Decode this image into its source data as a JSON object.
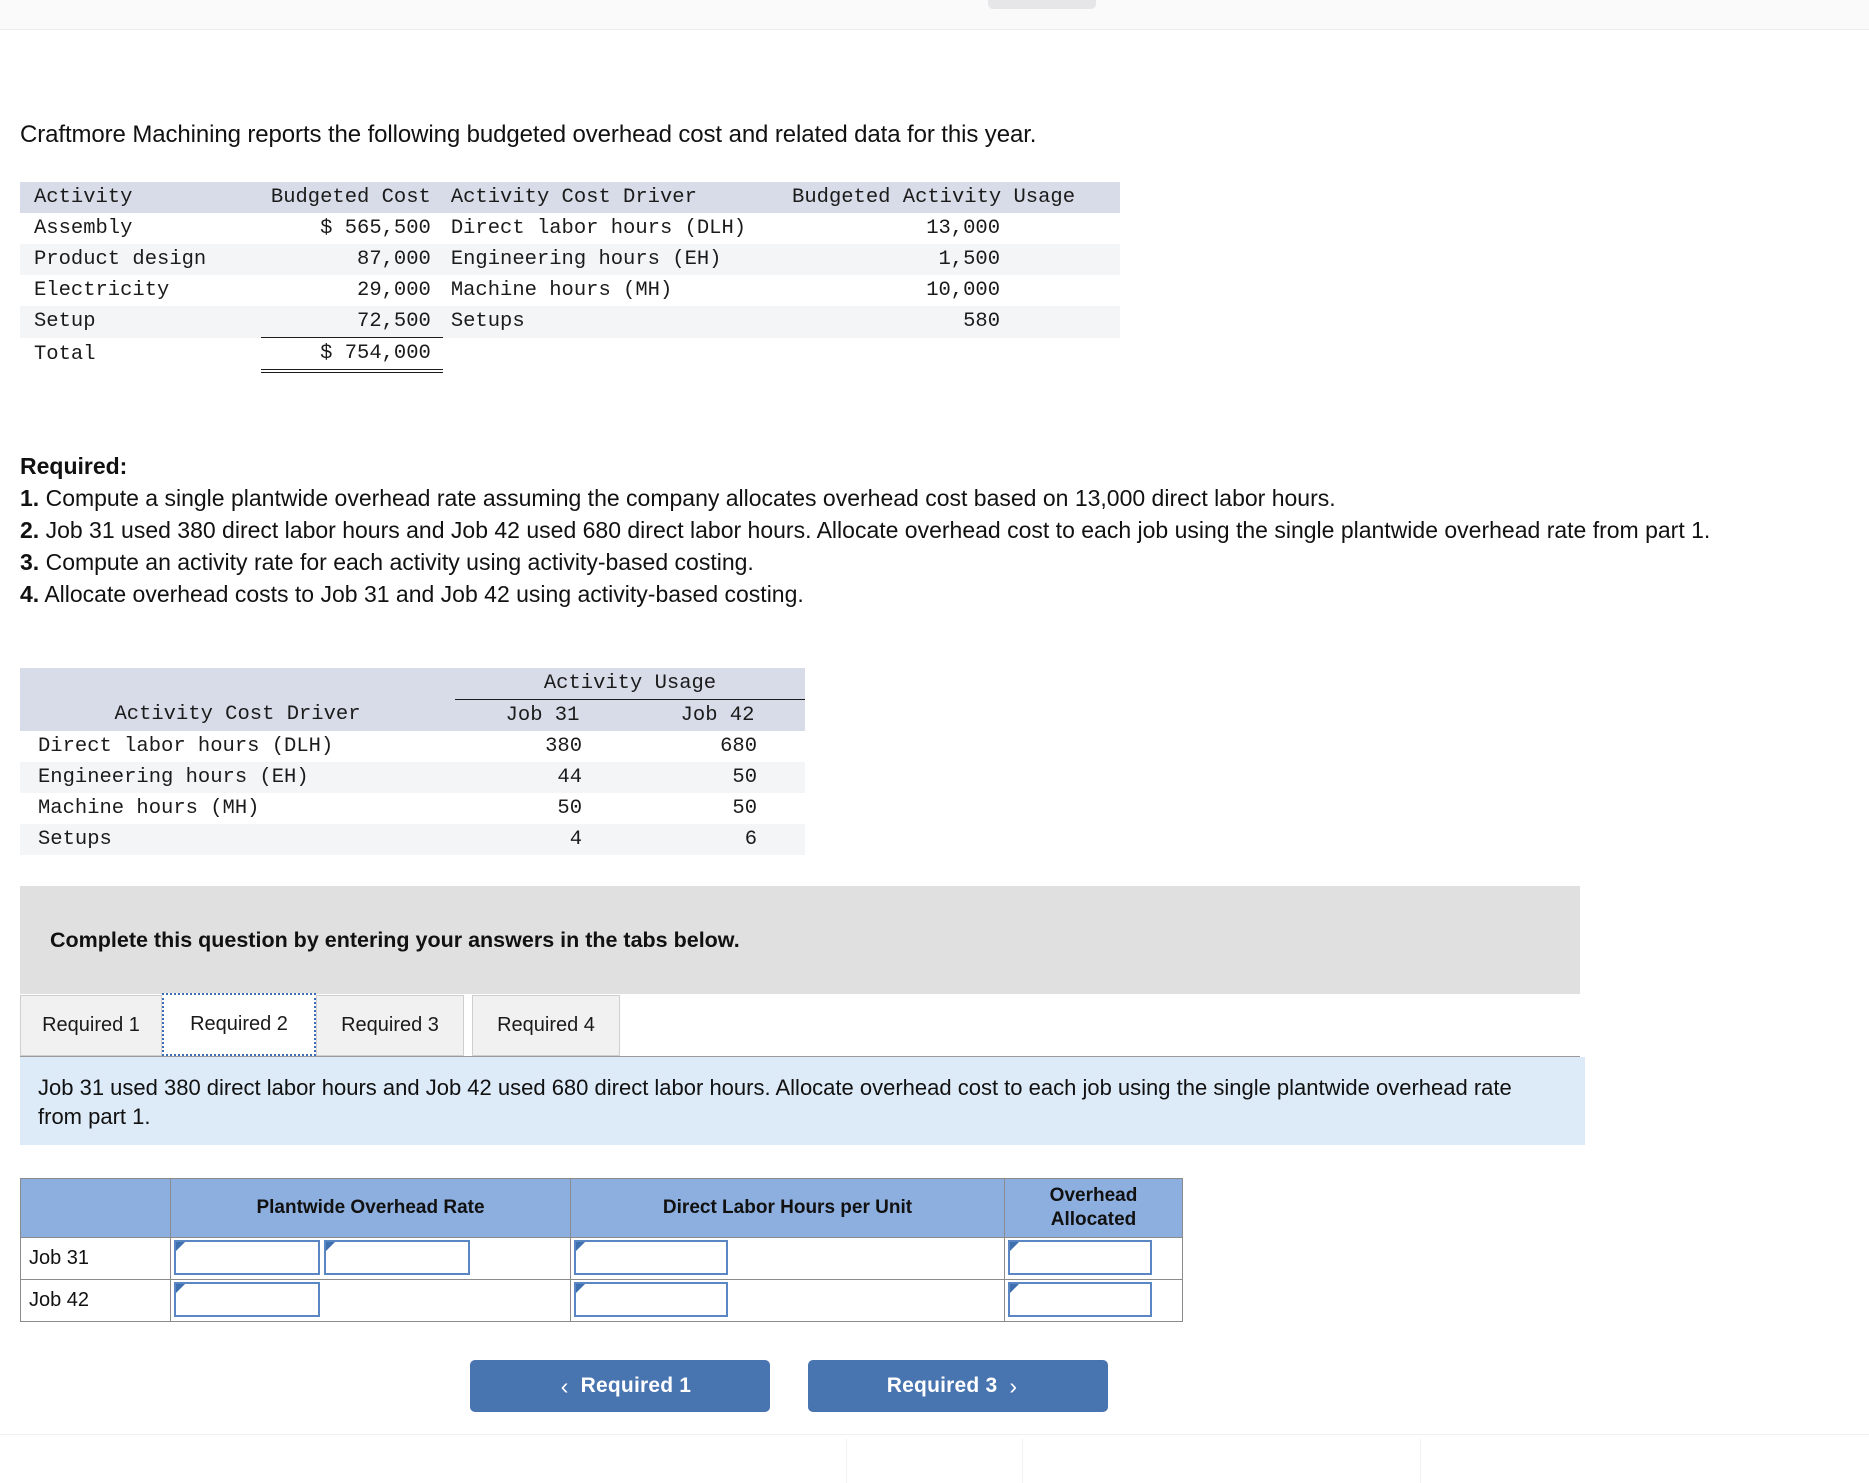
{
  "intro": "Craftmore Machining reports the following budgeted overhead cost and related data for this year.",
  "budget_table": {
    "headers": [
      "Activity",
      "Budgeted Cost",
      "Activity Cost Driver",
      "Budgeted Activity Usage"
    ],
    "rows": [
      {
        "activity": "Assembly",
        "cost": "$ 565,500",
        "driver": "Direct labor hours (DLH)",
        "usage": "13,000"
      },
      {
        "activity": "Product design",
        "cost": "87,000",
        "driver": "Engineering hours (EH)",
        "usage": "1,500"
      },
      {
        "activity": "Electricity",
        "cost": "29,000",
        "driver": "Machine hours (MH)",
        "usage": "10,000"
      },
      {
        "activity": "Setup",
        "cost": "72,500",
        "driver": "Setups",
        "usage": "580"
      }
    ],
    "total": {
      "activity": "Total",
      "cost": "$ 754,000"
    }
  },
  "required": {
    "heading": "Required:",
    "items": [
      {
        "num": "1.",
        "text": "Compute a single plantwide overhead rate assuming the company allocates overhead cost based on 13,000 direct labor hours."
      },
      {
        "num": "2.",
        "text": "Job 31 used 380 direct labor hours and Job 42 used 680 direct labor hours. Allocate overhead cost to each job using the single plantwide overhead rate from part 1."
      },
      {
        "num": "3.",
        "text": "Compute an activity rate for each activity using activity-based costing."
      },
      {
        "num": "4.",
        "text": "Allocate overhead costs to Job 31 and Job 42 using activity-based costing."
      }
    ]
  },
  "usage_table": {
    "span_header": "Activity Usage",
    "driver_header": "Activity Cost Driver",
    "sub_headers": [
      "Job 31",
      "Job 42"
    ],
    "rows": [
      {
        "driver": "Direct labor hours (DLH)",
        "job31": "380",
        "job42": "680"
      },
      {
        "driver": "Engineering hours (EH)",
        "job31": "44",
        "job42": "50"
      },
      {
        "driver": "Machine hours (MH)",
        "job31": "50",
        "job42": "50"
      },
      {
        "driver": "Setups",
        "job31": "4",
        "job42": "6"
      }
    ]
  },
  "banner": {
    "text": "Complete this question by entering your answers in the tabs below."
  },
  "tabs": {
    "items": [
      {
        "label": "Required 1",
        "active": false
      },
      {
        "label": "Required 2",
        "active": true
      },
      {
        "label": "Required 3",
        "active": false
      },
      {
        "label": "Required 4",
        "active": false
      }
    ]
  },
  "instruction": {
    "text": "Job 31 used 380 direct labor hours and Job 42 used 680 direct labor hours. Allocate overhead cost to each job using the single plantwide overhead rate from part 1."
  },
  "answer_grid": {
    "headers": [
      "",
      "Plantwide Overhead Rate",
      "Direct Labor Hours per Unit",
      "Overhead Allocated"
    ],
    "header_overhead_line1": "Overhead",
    "header_overhead_line2": "Allocated",
    "rows": [
      {
        "label": "Job 31",
        "plantwide_rate": "",
        "plantwide_rate_2": "",
        "dlh_per_unit": "",
        "overhead_allocated": ""
      },
      {
        "label": "Job 42",
        "plantwide_rate": "",
        "plantwide_rate_2": "",
        "dlh_per_unit": "",
        "overhead_allocated": ""
      }
    ]
  },
  "nav": {
    "prev_label": "Required 1",
    "prev_icon": "chevron-left-icon",
    "next_label": "Required 3",
    "next_icon": "chevron-right-icon"
  },
  "colors": {
    "table_header_gray": "#d7dce8",
    "row_shade": "#f4f5f6",
    "banner_gray": "#e0e0e0",
    "instruction_blue": "#ddeaf7",
    "grid_header_blue": "#8cafdf",
    "button_blue": "#4874b0",
    "active_tab_border": "#3b6fb5"
  }
}
